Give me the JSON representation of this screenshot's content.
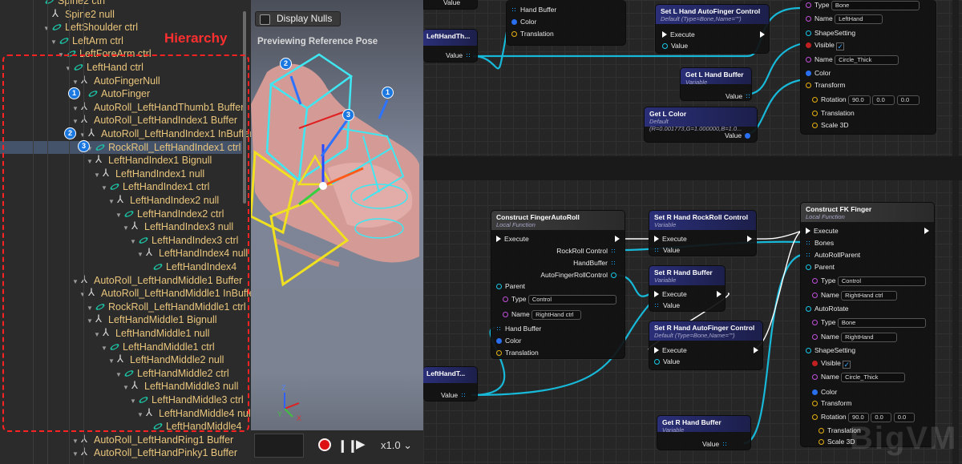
{
  "hierarchy": {
    "title": "Hierarchy",
    "rows": [
      {
        "label": "Spine2 ctrl",
        "type": "ctrl",
        "level": 5,
        "arrow": false
      },
      {
        "label": "Spine2 null",
        "type": "null",
        "level": 6,
        "arrow": false
      },
      {
        "label": "LeftShoulder ctrl",
        "type": "ctrl",
        "level": 6,
        "arrow": true
      },
      {
        "label": "LeftArm ctrl",
        "type": "ctrl",
        "level": 7,
        "arrow": true
      },
      {
        "label": "LeftForeArm ctrl",
        "type": "ctrl",
        "level": 8,
        "arrow": true
      },
      {
        "label": "LeftHand ctrl",
        "type": "ctrl",
        "level": 9,
        "arrow": true
      },
      {
        "label": "AutoFingerNull",
        "type": "null",
        "level": 10,
        "arrow": true
      },
      {
        "label": "AutoFinger",
        "type": "ctrl",
        "level": 11,
        "arrow": false
      },
      {
        "label": "AutoRoll_LeftHandThumb1 Buffer",
        "type": "null",
        "level": 10,
        "arrow": true
      },
      {
        "label": "AutoRoll_LeftHandIndex1 Buffer",
        "type": "null",
        "level": 10,
        "arrow": true
      },
      {
        "label": "AutoRoll_LeftHandIndex1 InBuffer",
        "type": "null",
        "level": 11,
        "arrow": true
      },
      {
        "label": "RockRoll_LeftHandIndex1 ctrl",
        "type": "ctrl",
        "level": 12,
        "arrow": true,
        "selected": true
      },
      {
        "label": "LeftHandIndex1 Bignull",
        "type": "null",
        "level": 12,
        "arrow": true
      },
      {
        "label": "LeftHandIndex1 null",
        "type": "null",
        "level": 13,
        "arrow": true
      },
      {
        "label": "LeftHandIndex1 ctrl",
        "type": "ctrl",
        "level": 14,
        "arrow": true
      },
      {
        "label": "LeftHandIndex2 null",
        "type": "null",
        "level": 15,
        "arrow": true
      },
      {
        "label": "LeftHandIndex2 ctrl",
        "type": "ctrl",
        "level": 16,
        "arrow": true
      },
      {
        "label": "LeftHandIndex3 null",
        "type": "null",
        "level": 17,
        "arrow": true
      },
      {
        "label": "LeftHandIndex3 ctrl",
        "type": "ctrl",
        "level": 18,
        "arrow": true
      },
      {
        "label": "LeftHandIndex4 null",
        "type": "null",
        "level": 19,
        "arrow": true
      },
      {
        "label": "LeftHandIndex4",
        "type": "ctrl",
        "level": 20,
        "arrow": false
      },
      {
        "label": "AutoRoll_LeftHandMiddle1 Buffer",
        "type": "null",
        "level": 10,
        "arrow": true
      },
      {
        "label": "AutoRoll_LeftHandMiddle1 InBuffer",
        "type": "null",
        "level": 11,
        "arrow": true
      },
      {
        "label": "RockRoll_LeftHandMiddle1 ctrl",
        "type": "ctrl",
        "level": 12,
        "arrow": true
      },
      {
        "label": "LeftHandMiddle1 Bignull",
        "type": "null",
        "level": 12,
        "arrow": true
      },
      {
        "label": "LeftHandMiddle1 null",
        "type": "null",
        "level": 13,
        "arrow": true
      },
      {
        "label": "LeftHandMiddle1 ctrl",
        "type": "ctrl",
        "level": 14,
        "arrow": true
      },
      {
        "label": "LeftHandMiddle2 null",
        "type": "null",
        "level": 15,
        "arrow": true
      },
      {
        "label": "LeftHandMiddle2 ctrl",
        "type": "ctrl",
        "level": 16,
        "arrow": true
      },
      {
        "label": "LeftHandMiddle3 null",
        "type": "null",
        "level": 17,
        "arrow": true
      },
      {
        "label": "LeftHandMiddle3 ctrl",
        "type": "ctrl",
        "level": 18,
        "arrow": true
      },
      {
        "label": "LeftHandMiddle4 null",
        "type": "null",
        "level": 19,
        "arrow": true
      },
      {
        "label": "LeftHandMiddle4",
        "type": "ctrl",
        "level": 20,
        "arrow": false
      },
      {
        "label": "AutoRoll_LeftHandRing1 Buffer",
        "type": "null",
        "level": 10,
        "arrow": true
      },
      {
        "label": "AutoRoll_LeftHandPinky1 Buffer",
        "type": "null",
        "level": 10,
        "arrow": true
      }
    ],
    "badges": {
      "b1": "1",
      "b2": "2",
      "b3": "3"
    }
  },
  "viewport": {
    "display_nulls": "Display Nulls",
    "preview": "Previewing Reference Pose",
    "speed": "x1.0 ⌄",
    "badge_2": "2",
    "badge_1": "1",
    "badge_3": "3",
    "axis_x": "X",
    "axis_y": "Y",
    "axis_z": "Z"
  },
  "graph": {
    "top": {
      "var_left_top": "Value",
      "var_left_mid_title": "LeftHandTh...",
      "var_left_mid_value": "Value",
      "node_partial": {
        "hand_buffer": "Hand Buffer",
        "color": "Color",
        "translation": "Translation"
      },
      "set_l_autofinger": {
        "title": "Set L Hand AutoFinger Control",
        "subtitle": "Default (Type=Bone,Name=\"\")",
        "execute": "Execute",
        "value": "Value"
      },
      "get_l_buffer": {
        "title": "Get L Hand Buffer",
        "subtitle": "Variable",
        "value": "Value"
      },
      "get_l_color": {
        "title": "Get L Color",
        "subtitle": "Default (R=0.001773,G=1.000000,B=1.0...",
        "value": "Value"
      },
      "panel": {
        "type": "Type",
        "type_value": "Bone",
        "name": "Name",
        "name_value": "LeftHand",
        "shape": "ShapeSetting",
        "visible": "Visible",
        "shape_name": "Name",
        "shape_name_value": "Circle_Thick",
        "color": "Color",
        "transform": "Transform",
        "rotation": "Rotation",
        "rx": "90.0",
        "ry": "0.0",
        "rz": "0.0",
        "translation": "Translation",
        "scale": "Scale 3D"
      }
    },
    "bottom": {
      "construct_autofinger": {
        "title": "Construct FingerAutoRoll",
        "subtitle": "Local Function",
        "execute": "Execute",
        "rockroll": "RockRoll Control",
        "handbuffer": "HandBuffer",
        "autofinger": "AutoFingerRollControl",
        "parent": "Parent",
        "type": "Type",
        "type_value": "Control",
        "name": "Name",
        "name_value": "RightHand ctrl",
        "hand_buffer": "Hand Buffer",
        "color": "Color",
        "translation": "Translation"
      },
      "set_r_rockroll": {
        "title": "Set R Hand RockRoll Control",
        "subtitle": "Variable",
        "execute": "Execute",
        "value": "Value"
      },
      "set_r_buffer": {
        "title": "Set R Hand Buffer",
        "subtitle": "Variable",
        "execute": "Execute",
        "value": "Value"
      },
      "set_r_autofinger": {
        "title": "Set R Hand AutoFinger Control",
        "subtitle": "Default (Type=Bone,Name=\"\")",
        "execute": "Execute",
        "value": "Value"
      },
      "get_r_buffer": {
        "title": "Get R Hand Buffer",
        "subtitle": "Variable",
        "value": "Value"
      },
      "var_left_title": "LeftHandT...",
      "var_left_value": "Value",
      "construct_fk": {
        "title": "Construct FK Finger",
        "subtitle": "Local Function",
        "execute": "Execute",
        "bones": "Bones",
        "autoroll_parent": "AutoRollParent",
        "parent": "Parent",
        "type": "Type",
        "type_value": "Control",
        "name": "Name",
        "name_value": "RightHand ctrl",
        "autorotate": "AutoRotate",
        "ar_type": "Type",
        "ar_type_value": "Bone",
        "ar_name": "Name",
        "ar_name_value": "RightHand",
        "shape": "ShapeSetting",
        "visible": "Visible",
        "shape_name": "Name",
        "shape_name_value": "Circle_Thick",
        "color": "Color",
        "transform": "Transform",
        "rotation": "Rotation",
        "rx": "90.0",
        "ry": "0.0",
        "rz": "0.0",
        "translation": "Translation",
        "scale": "Scale 3D"
      }
    },
    "watermark": "BigVM"
  }
}
